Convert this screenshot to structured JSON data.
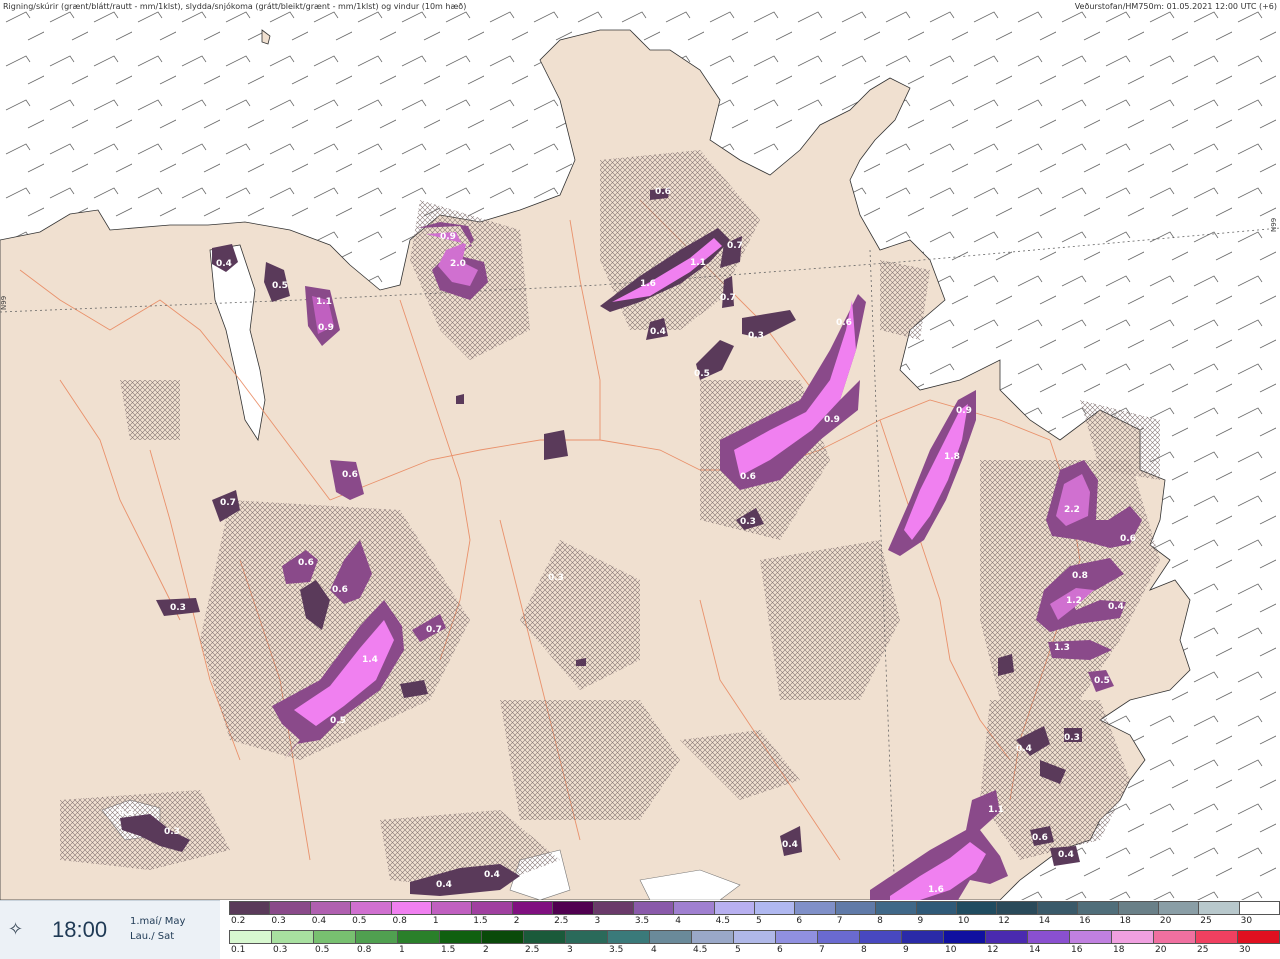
{
  "header": {
    "left": "Rigning/skúrir (grænt/blátt/rautt - mm/1klst), slydda/snjókoma (grátt/bleikt/grænt - mm/1klst) og vindur (10m hæð)",
    "right": "Veðurstofan/HM750m: 01.05.2021 12:00 UTC (+6)"
  },
  "footer": {
    "time": "18:00",
    "date_line1": "1.maí/ May",
    "date_line2": "Lau./ Sat",
    "icon": "sun-icon"
  },
  "gridlabels": {
    "left": "N99",
    "right": "N99"
  },
  "legend": {
    "snow_labels": [
      "0.2",
      "0.3",
      "0.4",
      "0.5",
      "0.8",
      "1",
      "1.5",
      "2",
      "2.5",
      "3",
      "3.5",
      "4",
      "4.5",
      "5",
      "6",
      "7",
      "8",
      "9",
      "10",
      "12",
      "14",
      "16",
      "18",
      "20",
      "25",
      "30"
    ],
    "snow_colors": [
      "#5a3a5a",
      "#8a4a8a",
      "#b060b0",
      "#d070d0",
      "#f080f0",
      "#c060c0",
      "#a040a0",
      "#801080",
      "#500050",
      "#6a3a6a",
      "#8a5aaa",
      "#a080d0",
      "#b8b0f0",
      "#b0b8f0",
      "#8090c8",
      "#607aa8",
      "#406888",
      "#305a78",
      "#204c60",
      "#2a4a5a",
      "#3a5a6a",
      "#506e7a",
      "#6a8088",
      "#8a9ea6",
      "#b8c8cc",
      "#ffffff"
    ],
    "rain_labels": [
      "0.1",
      "0.3",
      "0.5",
      "0.8",
      "1",
      "1.5",
      "2",
      "2.5",
      "3",
      "3.5",
      "4",
      "4.5",
      "5",
      "6",
      "7",
      "8",
      "9",
      "10",
      "12",
      "14",
      "16",
      "18",
      "20",
      "25",
      "30"
    ],
    "rain_colors": [
      "#d8f8d0",
      "#a8e0a0",
      "#78c070",
      "#50a050",
      "#2a802a",
      "#106010",
      "#0a4a0a",
      "#1a5a3a",
      "#2a6a5a",
      "#3a7a7a",
      "#6a8a9a",
      "#9aa8c8",
      "#b0b8e8",
      "#9090e0",
      "#6a6ad0",
      "#4848c0",
      "#2a2aa8",
      "#1010a0",
      "#4a2ab0",
      "#8a50d0",
      "#c080e0",
      "#f0a0e0",
      "#f070a0",
      "#f04060",
      "#e01020"
    ]
  },
  "precip_labels": [
    "0.4",
    "0.5",
    "1.1",
    "0.9",
    "0.9",
    "2.0",
    "0.6",
    "0.7",
    "1.6",
    "1.1",
    "0.7",
    "0.4",
    "0.3",
    "0.5",
    "0.6",
    "0.9",
    "0.6",
    "0.3",
    "0.9",
    "1.8",
    "2.2",
    "0.6",
    "0.8",
    "1.2",
    "0.4",
    "1.3",
    "0.5",
    "0.6",
    "0.6",
    "0.6",
    "0.3",
    "0.3",
    "0.7",
    "1.4",
    "0.5",
    "0.3",
    "0.3",
    "0.4",
    "0.4",
    "0.4",
    "0.3",
    "1.1",
    "0.4",
    "0.6",
    "0.4",
    "1.6",
    "0.7"
  ]
}
